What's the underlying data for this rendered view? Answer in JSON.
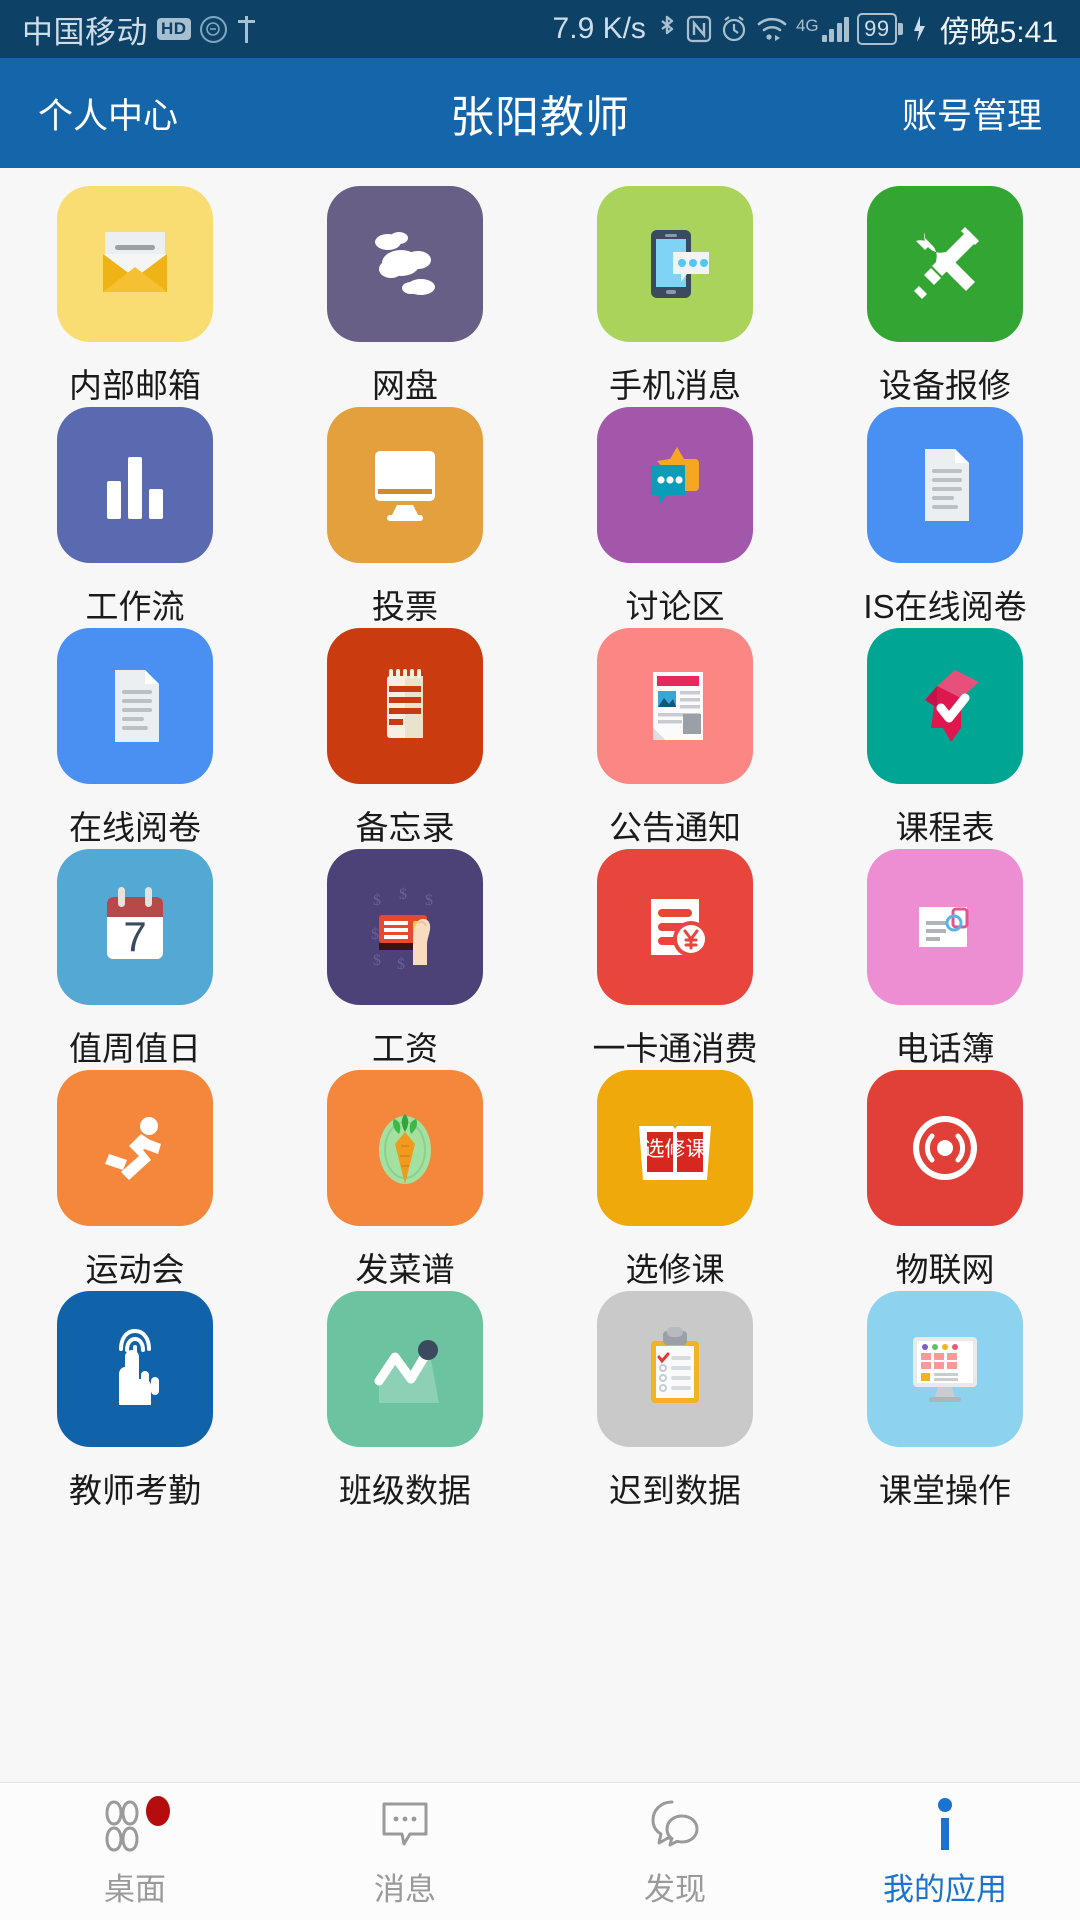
{
  "status_bar": {
    "carrier": "中国移动",
    "hd_badge": "HD",
    "icons": [
      "vpn-circle-icon",
      "usb-icon",
      "bluetooth-icon",
      "nfc-icon",
      "alarm-icon",
      "wifi-icon",
      "signal-icon",
      "charging-icon"
    ],
    "network_speed": "7.9 K/s",
    "network_type": "4G",
    "battery_level": "99",
    "time": "傍晚5:41",
    "background_color": "#0d4266"
  },
  "header": {
    "left_label": "个人中心",
    "title": "张阳教师",
    "right_label": "账号管理",
    "background_color": "#1565ab"
  },
  "apps": [
    {
      "label": "内部邮箱",
      "icon": "mail-icon",
      "bg": "#f9dd73"
    },
    {
      "label": "网盘",
      "icon": "cloud-icon",
      "bg": "#675f86"
    },
    {
      "label": "手机消息",
      "icon": "phone-message-icon",
      "bg": "#a9d35a"
    },
    {
      "label": "设备报修",
      "icon": "tools-icon",
      "bg": "#33a532"
    },
    {
      "label": "工作流",
      "icon": "bar-chart-icon",
      "bg": "#5a6ab0"
    },
    {
      "label": "投票",
      "icon": "monitor-icon",
      "bg": "#e5a03e"
    },
    {
      "label": "讨论区",
      "icon": "chat-bubbles-icon",
      "bg": "#a357ab"
    },
    {
      "label": "IS在线阅卷",
      "icon": "document-icon",
      "bg": "#4a90f2"
    },
    {
      "label": "在线阅卷",
      "icon": "document-icon",
      "bg": "#4a90f2"
    },
    {
      "label": "备忘录",
      "icon": "notepad-icon",
      "bg": "#ca3c10"
    },
    {
      "label": "公告通知",
      "icon": "newspaper-icon",
      "bg": "#fb8785"
    },
    {
      "label": "课程表",
      "icon": "check-flag-icon",
      "bg": "#00a693"
    },
    {
      "label": "值周值日",
      "icon": "calendar-icon",
      "bg": "#53a8d4"
    },
    {
      "label": "工资",
      "icon": "salary-card-icon",
      "bg": "#4c4277"
    },
    {
      "label": "一卡通消费",
      "icon": "card-yuan-icon",
      "bg": "#e8463c"
    },
    {
      "label": "电话簿",
      "icon": "contact-card-icon",
      "bg": "#ee8ed2"
    },
    {
      "label": "运动会",
      "icon": "running-icon",
      "bg": "#f4873c"
    },
    {
      "label": "发菜谱",
      "icon": "carrot-icon",
      "bg": "#f4873c"
    },
    {
      "label": "选修课",
      "icon": "elective-book-icon",
      "bg": "#f0a90b"
    },
    {
      "label": "物联网",
      "icon": "iot-signal-icon",
      "bg": "#e04038"
    },
    {
      "label": "教师考勤",
      "icon": "fingerprint-hand-icon",
      "bg": "#1063a8"
    },
    {
      "label": "班级数据",
      "icon": "line-chart-icon",
      "bg": "#6cc3a0"
    },
    {
      "label": "迟到数据",
      "icon": "clipboard-icon",
      "bg": "#c9c9c9"
    },
    {
      "label": "课堂操作",
      "icon": "desktop-board-icon",
      "bg": "#8dd3ef"
    }
  ],
  "tabbar": {
    "items": [
      {
        "label": "桌面",
        "icon": "grid-icon",
        "active": false,
        "badge": true
      },
      {
        "label": "消息",
        "icon": "message-icon",
        "active": false,
        "badge": false
      },
      {
        "label": "发现",
        "icon": "discover-icon",
        "active": false,
        "badge": false
      },
      {
        "label": "我的应用",
        "icon": "info-i-icon",
        "active": true,
        "badge": false
      }
    ],
    "active_color": "#1a73d0",
    "inactive_color": "#9a9a9a",
    "badge_color": "#b50d0d"
  }
}
